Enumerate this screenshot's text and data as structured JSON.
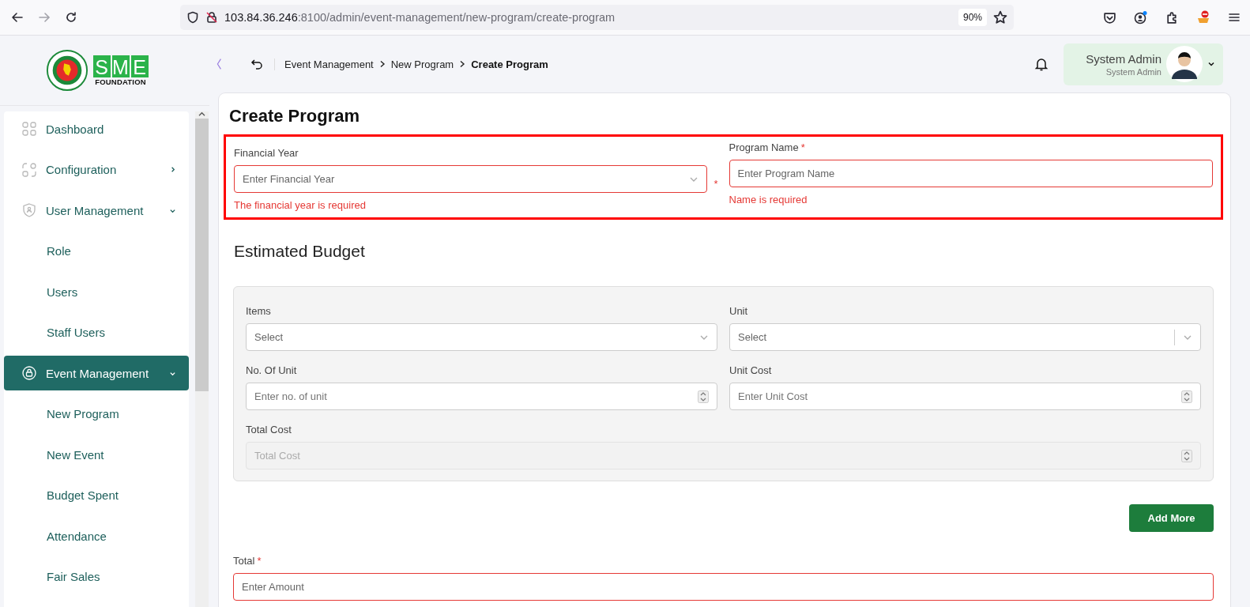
{
  "browser": {
    "url_host": "103.84.36.246",
    "url_rest": ":8100/admin/event-management/new-program/create-program",
    "zoom": "90%"
  },
  "logo": {
    "mark": "SME",
    "caption": "FOUNDATION"
  },
  "sidebar": {
    "items": [
      {
        "label": "Dashboard",
        "selected": false
      },
      {
        "label": "Configuration",
        "selected": false,
        "expanded": false
      },
      {
        "label": "User Management",
        "selected": false,
        "expanded": true,
        "children": [
          {
            "label": "Role",
            "selected": false
          },
          {
            "label": "Users",
            "selected": false
          },
          {
            "label": "Staff Users",
            "selected": false
          }
        ]
      },
      {
        "label": "Event Management",
        "selected": true,
        "expanded": true,
        "children": [
          {
            "label": "New Program",
            "selected": false
          },
          {
            "label": "New Event",
            "selected": false
          },
          {
            "label": "Budget Spent",
            "selected": false
          },
          {
            "label": "Attendance",
            "selected": false
          },
          {
            "label": "Fair Sales",
            "selected": false
          }
        ]
      }
    ]
  },
  "header": {
    "breadcrumb": [
      {
        "label": "Event Management",
        "current": false
      },
      {
        "label": "New Program",
        "current": false
      },
      {
        "label": "Create Program",
        "current": true
      }
    ],
    "user": {
      "name": "System Admin",
      "role": "System Admin"
    }
  },
  "form": {
    "title": "Create Program",
    "fields": [
      {
        "label": "Financial Year",
        "kind": "select",
        "placeholder": "Enter Financial Year",
        "required_mark": "*",
        "mark_after_field": true,
        "invalid": true,
        "error": "The financial year is required"
      },
      {
        "label": "Program Name",
        "kind": "text",
        "placeholder": "Enter Program Name",
        "required_mark": "*",
        "mark_after_field": false,
        "invalid": true,
        "error": "Name is required"
      }
    ]
  },
  "budget": {
    "title": "Estimated Budget",
    "fields": [
      {
        "label": "Items",
        "kind": "select",
        "placeholder": "Select",
        "separator": false,
        "disabled": false
      },
      {
        "label": "Unit",
        "kind": "select",
        "placeholder": "Select",
        "separator": true,
        "disabled": false
      },
      {
        "label": "No. Of Unit",
        "kind": "number",
        "placeholder": "Enter no. of unit",
        "disabled": false
      },
      {
        "label": "Unit Cost",
        "kind": "number",
        "placeholder": "Enter Unit Cost",
        "disabled": false
      },
      {
        "label": "Total Cost",
        "kind": "number",
        "placeholder": "Total Cost",
        "disabled": true
      }
    ],
    "add_button": "Add More"
  },
  "total": {
    "label": "Total",
    "required_mark": "*",
    "placeholder": "Enter Amount",
    "invalid": true
  }
}
